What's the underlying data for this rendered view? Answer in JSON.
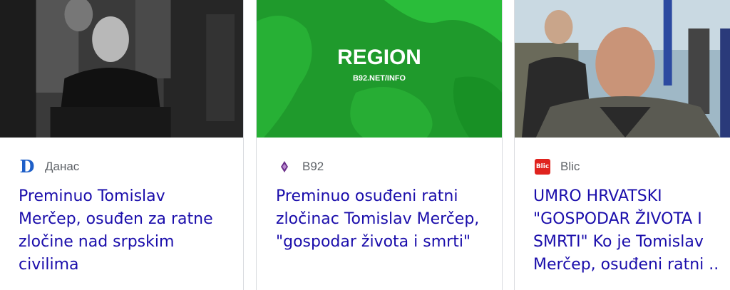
{
  "cards": [
    {
      "source": "Данас",
      "source_icon": "danas-logo-icon",
      "headline": "Preminuo Tomislav Merčep, osuđen za ratne zločine nad srpskim civilima"
    },
    {
      "source": "B92",
      "source_icon": "b92-logo-icon",
      "thumbnail_text": "REGION",
      "thumbnail_subtext": "B92.NET/INFO",
      "headline": "Preminuo osuđeni ratni zločinac Tomislav Merčep, \"gospodar života i smrti\""
    },
    {
      "source": "Blic",
      "source_icon": "blic-logo-icon",
      "source_icon_text": "Blic",
      "headline": "UMRO HRVATSKI \"GOSPODAR ŽIVOTA I SMRTI\" Ko je Tomislav Merčep, osuđeni ratni .."
    }
  ],
  "colors": {
    "headline": "#1a0dab",
    "source": "#5f6368",
    "border": "#dadce0",
    "region_green": "#1f9a2c"
  }
}
